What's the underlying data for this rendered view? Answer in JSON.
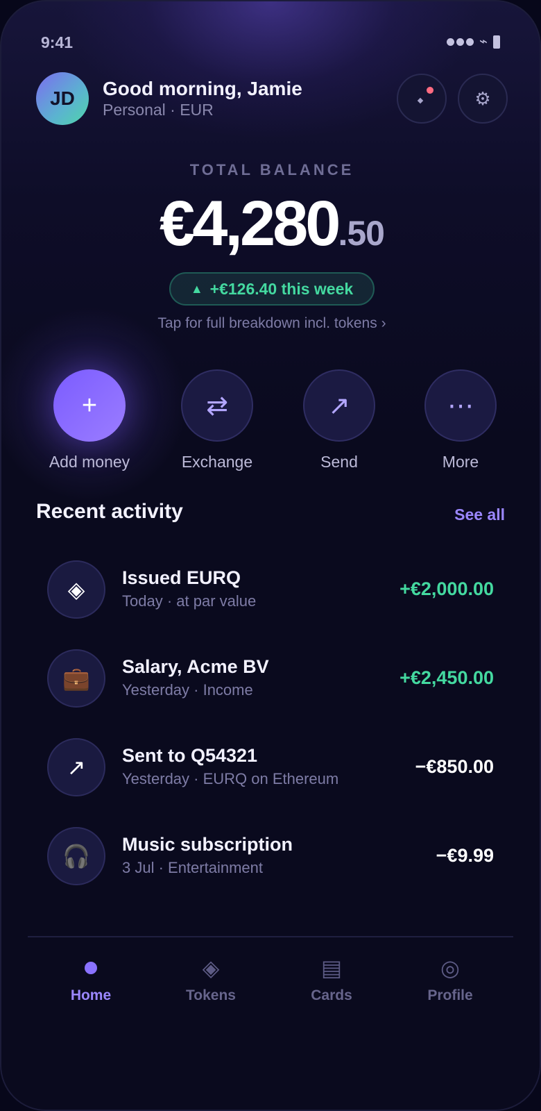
{
  "status_bar": {
    "time": "9:41"
  },
  "header": {
    "avatar_initials": "JD",
    "greeting": "Good morning, Jamie",
    "subtitle": "Personal · EUR",
    "notification_icon": "bell-icon",
    "settings_icon": "gear-icon"
  },
  "balance": {
    "label": "TOTAL BALANCE",
    "amount_main": "€4,280",
    "amount_cents": ".50",
    "change": "+€126.40 this week",
    "breakdown_link": "Tap for full breakdown incl. tokens ›"
  },
  "actions": [
    {
      "label": "Add money",
      "icon": "plus-icon",
      "glyph": "+"
    },
    {
      "label": "Exchange",
      "icon": "exchange-icon",
      "glyph": "⇄"
    },
    {
      "label": "Send",
      "icon": "send-arrow-icon",
      "glyph": "↗"
    },
    {
      "label": "More",
      "icon": "more-icon",
      "glyph": "⋯"
    }
  ],
  "activity": {
    "title": "Recent activity",
    "see_all": "See all",
    "items": [
      {
        "title": "Issued EURQ",
        "subtitle": "Today · at par value",
        "amount": "+€2,000.00",
        "icon": "token-icon",
        "glyph": "◈"
      },
      {
        "title": "Salary, Acme BV",
        "subtitle": "Yesterday · Income",
        "amount": "+€2,450.00",
        "icon": "briefcase-icon",
        "glyph": "💼"
      },
      {
        "title": "Sent to Q54321",
        "subtitle": "Yesterday · EURQ on Ethereum",
        "amount": "−€850.00",
        "icon": "send-arrow-icon",
        "glyph": "↗"
      },
      {
        "title": "Music subscription",
        "subtitle": "3 Jul · Entertainment",
        "amount": "−€9.99",
        "icon": "headphones-icon",
        "glyph": "🎧"
      }
    ]
  },
  "nav": [
    {
      "label": "Home",
      "icon": "home-icon",
      "active": true
    },
    {
      "label": "Tokens",
      "icon": "tokens-icon",
      "glyph": "◈"
    },
    {
      "label": "Cards",
      "icon": "cards-icon",
      "glyph": "▤"
    },
    {
      "label": "Profile",
      "icon": "profile-icon",
      "glyph": "◎"
    }
  ],
  "colors": {
    "accent": "#8a72ff",
    "positive": "#44d9a0",
    "background": "#0a0a1e",
    "notification": "#ff6b81"
  }
}
